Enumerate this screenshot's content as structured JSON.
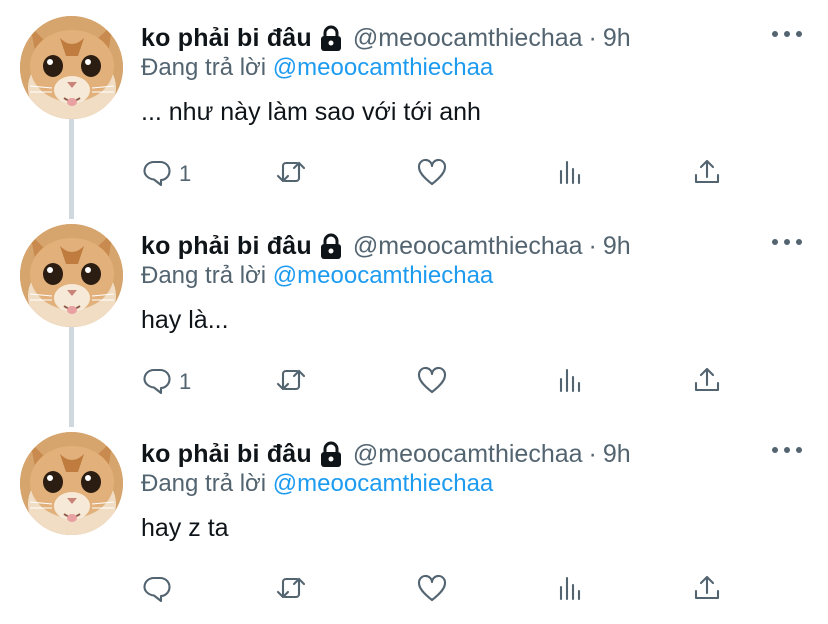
{
  "tweets": [
    {
      "name": "ko phải bi đâu",
      "handle": "@meoocamthiechaa",
      "time": "9h",
      "reply_prefix": "Đang trả lời",
      "reply_to": "@meoocamthiechaa",
      "text": "... như này làm sao với tới anh",
      "reply_count": "1"
    },
    {
      "name": "ko phải bi đâu",
      "handle": "@meoocamthiechaa",
      "time": "9h",
      "reply_prefix": "Đang trả lời",
      "reply_to": "@meoocamthiechaa",
      "text": "hay là...",
      "reply_count": "1"
    },
    {
      "name": "ko phải bi đâu",
      "handle": "@meoocamthiechaa",
      "time": "9h",
      "reply_prefix": "Đang trả lời",
      "reply_to": "@meoocamthiechaa",
      "text": "hay z ta",
      "reply_count": ""
    }
  ],
  "separator": "·",
  "icons": {
    "lock": "lock-icon",
    "more": "more-icon",
    "reply": "reply-icon",
    "retweet": "retweet-icon",
    "like": "heart-icon",
    "views": "views-icon",
    "share": "share-icon"
  },
  "colors": {
    "accent": "#1d9bf0",
    "secondary": "#536471",
    "thread_line": "#cfd9de"
  }
}
